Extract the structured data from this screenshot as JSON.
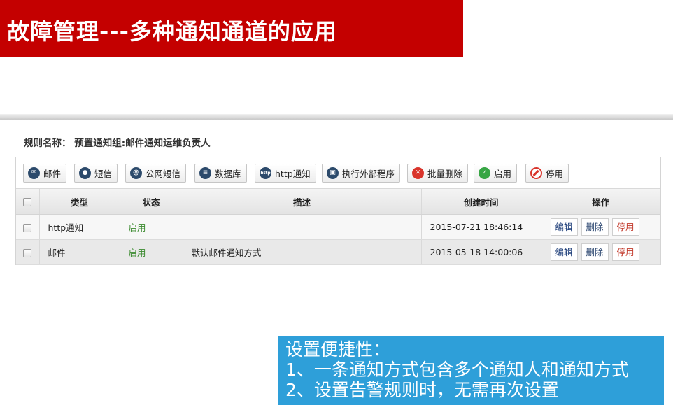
{
  "slide": {
    "title": "故障管理---多种通知通道的应用"
  },
  "rule": {
    "label": "规则名称：",
    "value": "预置通知组:邮件通知运维负责人"
  },
  "toolbar": {
    "buttons": [
      {
        "label": "邮件",
        "icon": "mail-icon"
      },
      {
        "label": "短信",
        "icon": "chat-icon"
      },
      {
        "label": "公网短信",
        "icon": "public-sms-icon"
      },
      {
        "label": "数据库",
        "icon": "database-icon"
      },
      {
        "label": "http通知",
        "icon": "http-icon"
      },
      {
        "label": "执行外部程序",
        "icon": "program-icon"
      },
      {
        "label": "批量删除",
        "icon": "delete-icon"
      },
      {
        "label": "启用",
        "icon": "check-icon"
      },
      {
        "label": "停用",
        "icon": "ban-icon"
      }
    ]
  },
  "table": {
    "headers": [
      "类型",
      "状态",
      "描述",
      "创建时间",
      "操作"
    ],
    "rows": [
      {
        "type": "http通知",
        "status": "启用",
        "desc": "",
        "created": "2015-07-21 18:46:14",
        "actions": [
          "编辑",
          "删除",
          "停用"
        ]
      },
      {
        "type": "邮件",
        "status": "启用",
        "desc": "默认邮件通知方式",
        "created": "2015-05-18 14:00:06",
        "actions": [
          "编辑",
          "删除",
          "停用"
        ]
      }
    ]
  },
  "callout": {
    "lines": [
      "设置便捷性：",
      "1、一条通知方式包含多个通知人和通知方式",
      "2、设置告警规则时，无需再次设置"
    ]
  },
  "colors": {
    "title_bg": "#c40000",
    "callout_bg": "#2e9fd9",
    "enabled_text": "#3a8a2e",
    "stop_text": "#c23a2c"
  }
}
